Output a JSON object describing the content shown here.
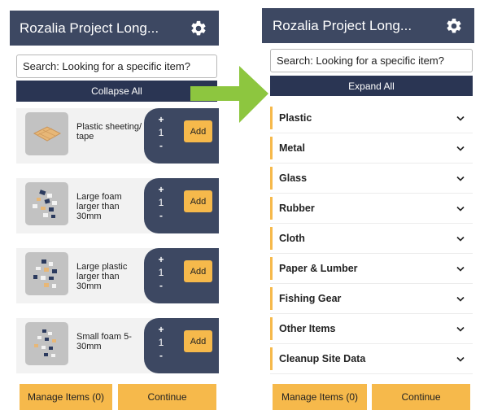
{
  "colors": {
    "header_bg": "#3d4862",
    "toggle_bg": "#2a3553",
    "accent_orange": "#f6b94b",
    "arrow_green": "#8dc63f",
    "card_bg": "#f2f2f2",
    "thumb_bg": "#c2c2c2"
  },
  "left": {
    "header": {
      "title": "Rozalia Project Long...",
      "icon": "gear-icon"
    },
    "search": {
      "value": "Search: Looking for a specific item?"
    },
    "collapse_label": "Collapse All",
    "items": [
      {
        "label": "Plastic sheeting/ tape",
        "plus": "+",
        "qty": "1",
        "minus": "-",
        "add": "Add",
        "icon": "plastic-sheet-icon"
      },
      {
        "label": "Large foam larger than 30mm",
        "plus": "+",
        "qty": "1",
        "minus": "-",
        "add": "Add",
        "icon": "foam-icon"
      },
      {
        "label": "Large plastic larger than 30mm",
        "plus": "+",
        "qty": "1",
        "minus": "-",
        "add": "Add",
        "icon": "plastic-pieces-icon"
      },
      {
        "label": "Small foam 5-30mm",
        "plus": "+",
        "qty": "1",
        "minus": "-",
        "add": "Add",
        "icon": "foam-icon"
      }
    ],
    "manage_label": "Manage Items (0)",
    "continue_label": "Continue"
  },
  "right": {
    "header": {
      "title": "Rozalia Project Long...",
      "icon": "gear-icon"
    },
    "search": {
      "value": "Search: Looking for a specific item?"
    },
    "expand_label": "Expand All",
    "categories": [
      "Plastic",
      "Metal",
      "Glass",
      "Rubber",
      "Cloth",
      "Paper & Lumber",
      "Fishing Gear",
      "Other Items",
      "Cleanup Site Data"
    ],
    "manage_label": "Manage Items (0)",
    "continue_label": "Continue"
  }
}
